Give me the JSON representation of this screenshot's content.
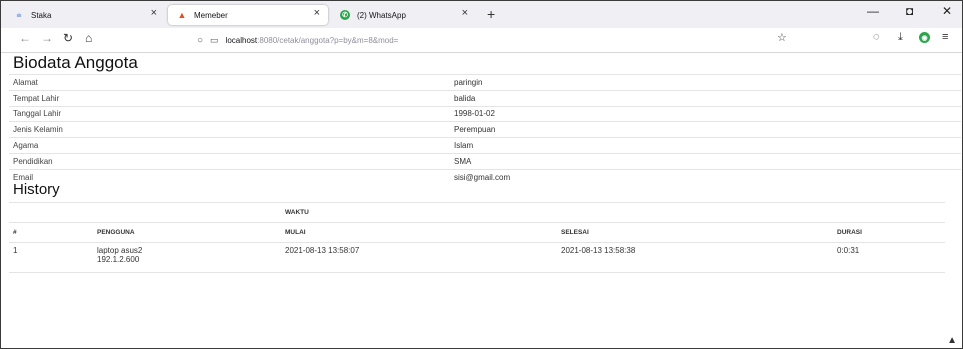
{
  "browser": {
    "tabs": [
      {
        "label": "Staka",
        "icon": "staka-favicon",
        "active": false
      },
      {
        "label": "Memeber",
        "icon": "memeber-favicon",
        "active": true
      },
      {
        "label": "(2) WhatsApp",
        "icon": "whatsapp-favicon",
        "active": false
      }
    ],
    "url_host": "localhost",
    "url_path": ":8080/cetak/anggota?p=by&m=8&mod=",
    "accent": "#2da44e"
  },
  "page": {
    "title": "Biodata Anggota",
    "bio": [
      {
        "label": "Alamat",
        "value": "paringin"
      },
      {
        "label": "Tempat Lahir",
        "value": "balida"
      },
      {
        "label": "Tanggal Lahir",
        "value": "1998-01-02"
      },
      {
        "label": "Jenis Kelamin",
        "value": "Perempuan"
      },
      {
        "label": "Agama",
        "value": "Islam"
      },
      {
        "label": "Pendidikan",
        "value": "SMA"
      },
      {
        "label": "Email",
        "value": "sisi@gmail.com"
      }
    ],
    "history_title": "History",
    "history_headers": {
      "group": "WAKTU",
      "no": "#",
      "pengguna": "PENGGUNA",
      "mulai": "MULAI",
      "selesai": "SELESAI",
      "durasi": "DURASI"
    },
    "history_rows": [
      {
        "no": "1",
        "device": "laptop asus2",
        "ip": "192.1.2.600",
        "mulai": "2021-08-13 13:58:07",
        "selesai": "2021-08-13 13:58:38",
        "durasi": "0:0:31"
      }
    ]
  }
}
